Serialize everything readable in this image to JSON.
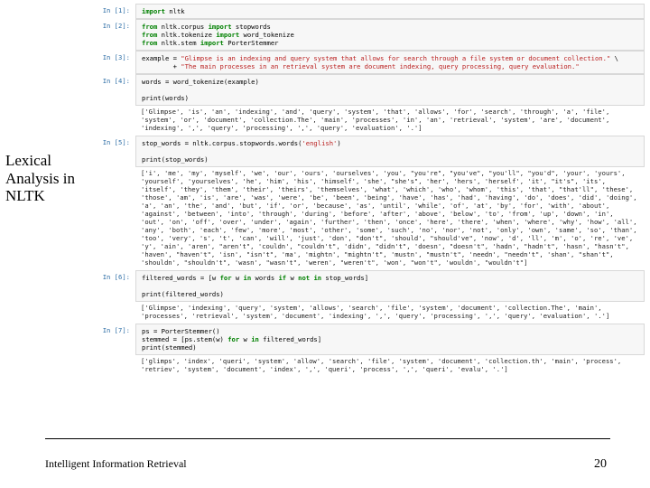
{
  "sidebar_title": "Lexical Analysis in NLTK",
  "footer": {
    "left": "Intelligent Information Retrieval",
    "right": "20"
  },
  "cells": [
    {
      "prompt": "In [1]:",
      "type": "code",
      "code_html": "<span class='kw'>import</span> <span class='nm'>nltk</span>"
    },
    {
      "prompt": "In [2]:",
      "type": "code",
      "code_html": "<span class='kw'>from</span> <span class='nm'>nltk.corpus</span> <span class='kw'>import</span> <span class='nm'>stopwords</span>\n<span class='kw'>from</span> <span class='nm'>nltk.tokenize</span> <span class='kw'>import</span> <span class='nm'>word_tokenize</span>\n<span class='kw'>from</span> <span class='nm'>nltk.stem</span> <span class='kw'>import</span> <span class='nm'>PorterStemmer</span>"
    },
    {
      "prompt": "In [3]:",
      "type": "code",
      "code_html": "<span class='nm'>example</span> = <span class='str'>\"Glimpse is an indexing and query system that allows for search through a file system or document collection.\"</span> \\\n        + <span class='str'>\"The main processes in an retrieval system are document indexing, query processing, query evaluation.\"</span>"
    },
    {
      "prompt": "In [4]:",
      "type": "code",
      "code_html": "<span class='nm'>words</span> = word_tokenize(example)\n\n<span class='fn'>print</span>(words)"
    },
    {
      "prompt": "",
      "type": "out",
      "text": "['Glimpse', 'is', 'an', 'indexing', 'and', 'query', 'system', 'that', 'allows', 'for', 'search', 'through', 'a', 'file', 'system', 'or', 'document', 'collection.The', 'main', 'processes', 'in', 'an', 'retrieval', 'system', 'are', 'document', 'indexing', ',', 'query', 'processing', ',', 'query', 'evaluation', '.']"
    },
    {
      "prompt": "In [5]:",
      "type": "code",
      "code_html": "<span class='nm'>stop_words</span> = nltk.corpus.stopwords.words(<span class='str'>'english'</span>)\n\n<span class='fn'>print</span>(stop_words)"
    },
    {
      "prompt": "",
      "type": "out",
      "text": "['i', 'me', 'my', 'myself', 'we', 'our', 'ours', 'ourselves', 'you', \"you're\", \"you've\", \"you'll\", \"you'd\", 'your', 'yours', 'yourself', 'yourselves', 'he', 'him', 'his', 'himself', 'she', \"she's\", 'her', 'hers', 'herself', 'it', \"it's\", 'its', 'itself', 'they', 'them', 'their', 'theirs', 'themselves', 'what', 'which', 'who', 'whom', 'this', 'that', \"that'll\", 'these', 'those', 'am', 'is', 'are', 'was', 'were', 'be', 'been', 'being', 'have', 'has', 'had', 'having', 'do', 'does', 'did', 'doing', 'a', 'an', 'the', 'and', 'but', 'if', 'or', 'because', 'as', 'until', 'while', 'of', 'at', 'by', 'for', 'with', 'about', 'against', 'between', 'into', 'through', 'during', 'before', 'after', 'above', 'below', 'to', 'from', 'up', 'down', 'in', 'out', 'on', 'off', 'over', 'under', 'again', 'further', 'then', 'once', 'here', 'there', 'when', 'where', 'why', 'how', 'all', 'any', 'both', 'each', 'few', 'more', 'most', 'other', 'some', 'such', 'no', 'nor', 'not', 'only', 'own', 'same', 'so', 'than', 'too', 'very', 's', 't', 'can', 'will', 'just', 'don', \"don't\", 'should', \"should've\", 'now', 'd', 'll', 'm', 'o', 're', 've', 'y', 'ain', 'aren', \"aren't\", 'couldn', \"couldn't\", 'didn', \"didn't\", 'doesn', \"doesn't\", 'hadn', \"hadn't\", 'hasn', \"hasn't\", 'haven', \"haven't\", 'isn', \"isn't\", 'ma', 'mightn', \"mightn't\", 'mustn', \"mustn't\", 'needn', \"needn't\", 'shan', \"shan't\", 'shouldn', \"shouldn't\", 'wasn', \"wasn't\", 'weren', \"weren't\", 'won', \"won't\", 'wouldn', \"wouldn't\"]"
    },
    {
      "prompt": "In [6]:",
      "type": "code",
      "code_html": "<span class='nm'>filtered_words</span> = [w <span class='kw'>for</span> w <span class='kw'>in</span> words <span class='kw'>if</span> w <span class='kw'>not</span> <span class='kw'>in</span> stop_words]\n\n<span class='fn'>print</span>(filtered_words)"
    },
    {
      "prompt": "",
      "type": "out",
      "text": "['Glimpse', 'indexing', 'query', 'system', 'allows', 'search', 'file', 'system', 'document', 'collection.The', 'main', 'processes', 'retrieval', 'system', 'document', 'indexing', ',', 'query', 'processing', ',', 'query', 'evaluation', '.']"
    },
    {
      "prompt": "In [7]:",
      "type": "code",
      "code_html": "<span class='nm'>ps</span> = PorterStemmer()\n<span class='nm'>stemmed</span> = [ps.stem(w) <span class='kw'>for</span> w <span class='kw'>in</span> filtered_words]\n<span class='fn'>print</span>(stemmed)"
    },
    {
      "prompt": "",
      "type": "out",
      "text": "['glimps', 'index', 'queri', 'system', 'allow', 'search', 'file', 'system', 'document', 'collection.th', 'main', 'process', 'retriev', 'system', 'document', 'index', ',', 'queri', 'process', ',', 'queri', 'evalu', '.']"
    }
  ]
}
